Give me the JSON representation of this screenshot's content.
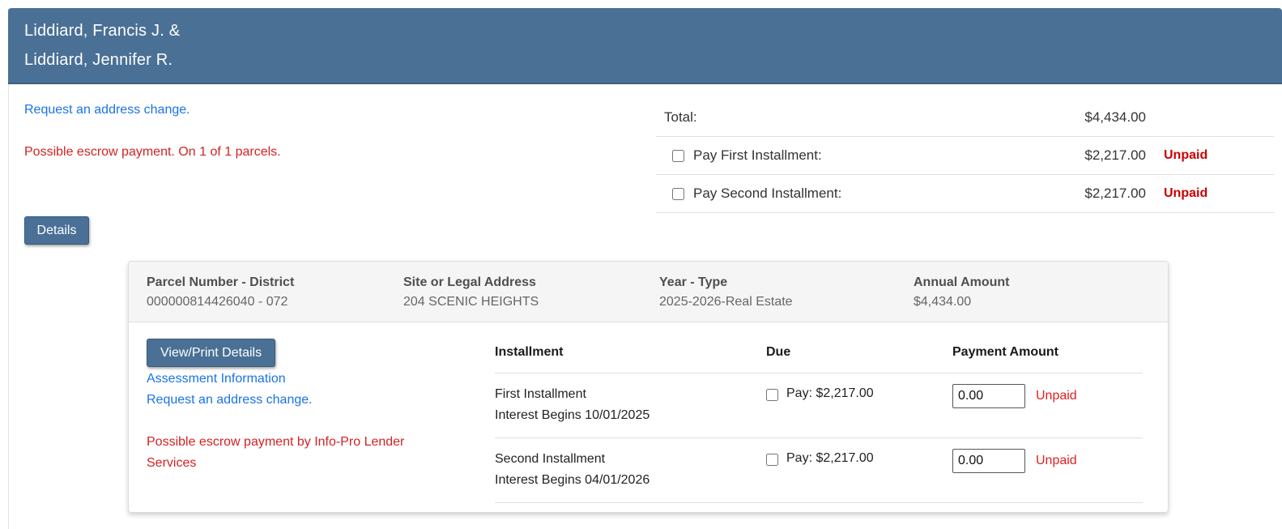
{
  "colors": {
    "header_bg": "#4a7096",
    "header_border": "#3d5e80",
    "button_bg": "#4a7096",
    "button_border": "#395b7c",
    "link": "#1a73e8",
    "red": "#d32222",
    "unpaid_bold": "#cc0000"
  },
  "header": {
    "owner_line1": "Liddiard, Francis J. &",
    "owner_line2": "Liddiard, Jennifer R."
  },
  "messages": {
    "address_change": "Request an address change.",
    "escrow": "Possible escrow payment. On 1 of 1 parcels."
  },
  "summary": {
    "total_label": "Total:",
    "total_amount": "$4,434.00",
    "rows": [
      {
        "label": "Pay First Installment:",
        "amount": "$2,217.00",
        "status": "Unpaid"
      },
      {
        "label": "Pay Second Installment:",
        "amount": "$2,217.00",
        "status": "Unpaid"
      }
    ]
  },
  "details_button_label": "Details",
  "panel": {
    "header": {
      "parcel_label": "Parcel Number - District",
      "parcel_value": "000000814426040 - 072",
      "site_label": "Site or Legal Address",
      "site_value": "204 SCENIC HEIGHTS",
      "year_label": "Year - Type",
      "year_value": "2025-2026-Real Estate",
      "amount_label": "Annual Amount",
      "amount_value": "$4,434.00"
    },
    "actions": {
      "view_print": "View/Print Details",
      "assessment": "Assessment Information",
      "address_change": "Request an address change.",
      "escrow": "Possible escrow payment by Info-Pro Lender Services"
    },
    "table": {
      "headers": {
        "installment": "Installment",
        "due": "Due",
        "payment": "Payment Amount"
      },
      "rows": [
        {
          "name": "First Installment",
          "interest": "Interest Begins 10/01/2025",
          "pay": "Pay: $2,217.00",
          "amount_value": "0.00",
          "status": "Unpaid"
        },
        {
          "name": "Second Installment",
          "interest": "Interest Begins 04/01/2026",
          "pay": "Pay: $2,217.00",
          "amount_value": "0.00",
          "status": "Unpaid"
        }
      ]
    }
  }
}
